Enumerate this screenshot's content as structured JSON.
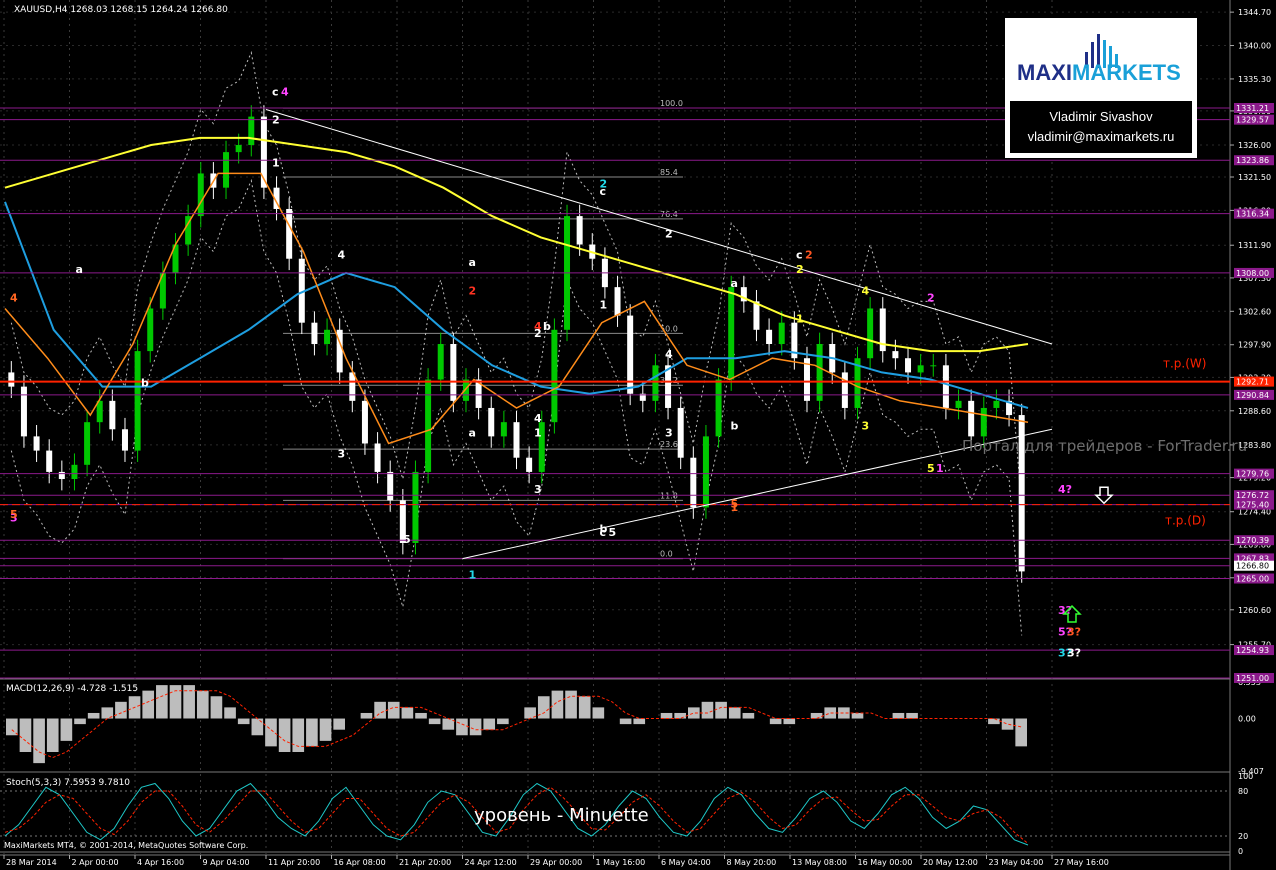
{
  "header": {
    "symbol_info": "XAUUSD,H4  1268.03 1268.15 1264.24 1266.80",
    "macd_info": "MACD(12,26,9) -4.728 -1.515",
    "stoch_info": "Stoch(5,3,3) 7.5953 9.7810"
  },
  "logo": {
    "brand_part1": "MAXI",
    "brand_part2": "MARKETS",
    "author": "Vladimir Sivashov",
    "email": "vladimir@maximarkets.ru"
  },
  "texts": {
    "watermark": "Портал для трейдеров - ForTrader.ru",
    "wave_level": "уровень - Minuette",
    "copyright": "MaxiMarkets MT4, © 2001-2014, MetaQuotes Software Corp."
  },
  "colors": {
    "background": "#000000",
    "bull_candle": "#00c800",
    "bear_candle": "#ffffff",
    "ma_slow": "#ffff33",
    "ma_mid": "#1e9ee0",
    "ma_fast": "#ff8c1a",
    "tp_line": "#ff2200",
    "level_line": "#8b1a8b"
  },
  "chart_data": [
    {
      "type": "line",
      "title": "XAUUSD,H4",
      "ylim": [
        1251.0,
        1345.0
      ],
      "y_ticks": [
        "1344.70",
        "1340.00",
        "1335.30",
        "1330.80",
        "1326.00",
        "1321.50",
        "1316.80",
        "1311.90",
        "1307.30",
        "1302.60",
        "1297.90",
        "1293.30",
        "1288.60",
        "1283.80",
        "1279.20",
        "1274.40",
        "1269.80",
        "1265.10",
        "1260.60",
        "1255.70"
      ],
      "price_tags": [
        "1331.21",
        "1329.57",
        "1323.86",
        "1316.34",
        "1308.00",
        "1292.71",
        "1290.84",
        "1279.76",
        "1276.72",
        "1275.40",
        "1270.39",
        "1267.83",
        "1266.80",
        "1265.00",
        "1254.93",
        "1251.00"
      ],
      "x_ticks": [
        "28 Mar 2014",
        "2 Apr 00:00",
        "4 Apr 16:00",
        "9 Apr 04:00",
        "11 Apr 20:00",
        "16 Apr 08:00",
        "21 Apr 20:00",
        "24 Apr 12:00",
        "29 Apr 00:00",
        "1 May 16:00",
        "6 May 04:00",
        "8 May 20:00",
        "13 May 08:00",
        "16 May 00:00",
        "20 May 12:00",
        "23 May 04:00",
        "27 May 16:00"
      ],
      "close_path": [
        1292,
        1285,
        1283,
        1280,
        1279,
        1281,
        1287,
        1290,
        1286,
        1283,
        1297,
        1303,
        1308,
        1312,
        1316,
        1322,
        1320,
        1325,
        1326,
        1330,
        1320,
        1317,
        1310,
        1301,
        1298,
        1300,
        1294,
        1290,
        1284,
        1280,
        1276,
        1270,
        1280,
        1293,
        1298,
        1290,
        1293,
        1289,
        1285,
        1287,
        1282,
        1280,
        1287,
        1300,
        1316,
        1312,
        1310,
        1306,
        1302,
        1291,
        1290,
        1295,
        1289,
        1282,
        1275,
        1285,
        1293,
        1306,
        1304,
        1300,
        1298,
        1301,
        1296,
        1290,
        1298,
        1294,
        1289,
        1296,
        1303,
        1297,
        1296,
        1294,
        1295,
        1295,
        1289,
        1290,
        1285,
        1289,
        1290,
        1288,
        1266
      ],
      "ma_slow": [
        1320,
        1322,
        1324,
        1326,
        1327,
        1327,
        1326,
        1325,
        1323,
        1320,
        1316,
        1313,
        1311,
        1309,
        1307,
        1305,
        1302,
        1300,
        1298,
        1297,
        1297,
        1298
      ],
      "ma_mid": [
        1318,
        1300,
        1292,
        1292,
        1296,
        1300,
        1305,
        1308,
        1306,
        1300,
        1295,
        1292,
        1291,
        1292,
        1296,
        1296,
        1297,
        1296,
        1294,
        1293,
        1291,
        1289
      ],
      "ma_fast": [
        1303,
        1296,
        1288,
        1298,
        1312,
        1322,
        1322,
        1311,
        1296,
        1284,
        1286,
        1293,
        1289,
        1292,
        1301,
        1304,
        1295,
        1293,
        1296,
        1295,
        1292,
        1290,
        1289,
        1288,
        1287
      ],
      "levels": [
        {
          "name": "т.р.(W)",
          "value": 1292.71
        },
        {
          "name": "т.р.(D)",
          "value": 1275.4
        }
      ],
      "trend_lines": [
        {
          "from": [
            "11 Apr 20:00",
            1331
          ],
          "to": [
            "27 May 16:00",
            1298
          ]
        },
        {
          "from": [
            "24 Apr 12:00",
            1267.8
          ],
          "to": [
            "27 May 16:00",
            1286
          ]
        }
      ],
      "fibonacci": [
        {
          "label": "100.0",
          "value": 1331.2
        },
        {
          "label": "85.4",
          "value": 1321.5
        },
        {
          "label": "76.4",
          "value": 1315.6
        },
        {
          "label": "50.0",
          "value": 1299.5
        },
        {
          "label": "38.2",
          "value": 1292.2
        },
        {
          "label": "23.6",
          "value": 1283.2
        },
        {
          "label": "11.8",
          "value": 1276.0
        },
        {
          "label": "0.0",
          "value": 1267.8
        }
      ],
      "wave_labels": [
        {
          "text": "c",
          "color": "#ffffff",
          "x": "11 Apr 20:00",
          "y": 1333.0
        },
        {
          "text": "4",
          "color": "#ff44ff",
          "x": "11 Apr 20:00",
          "y": 1333.0
        },
        {
          "text": "2",
          "color": "#ffffff",
          "x": "11 Apr 20:00",
          "y": 1329.0
        },
        {
          "text": "1",
          "color": "#ffffff",
          "x": "11 Apr 20:00",
          "y": 1323.0
        },
        {
          "text": "4",
          "color": "#ffffff",
          "x": "16 Apr 08:00",
          "y": 1310.0
        },
        {
          "text": "3",
          "color": "#ffffff",
          "x": "16 Apr 08:00",
          "y": 1282.0
        },
        {
          "text": "5",
          "color": "#ffffff",
          "x": "21 Apr 20:00",
          "y": 1270.0
        },
        {
          "text": "1",
          "color": "#22d8e8",
          "x": "24 Apr 12:00",
          "y": 1265.0
        },
        {
          "text": "a",
          "color": "#ffffff",
          "x": "2 Apr 00:00",
          "y": 1308.0
        },
        {
          "text": "b",
          "color": "#ffffff",
          "x": "4 Apr 16:00",
          "y": 1292.0
        },
        {
          "text": "4",
          "color": "#ff6622",
          "x": "28 Mar 2014",
          "y": 1304.0
        },
        {
          "text": "3",
          "color": "#ff44ff",
          "x": "28 Mar 2014",
          "y": 1273.0
        },
        {
          "text": "5",
          "color": "#ff6622",
          "x": "28 Mar 2014",
          "y": 1273.5
        },
        {
          "text": "a",
          "color": "#ffffff",
          "x": "24 Apr 12:00",
          "y": 1309.0
        },
        {
          "text": "2",
          "color": "#ff3322",
          "x": "24 Apr 12:00",
          "y": 1305.0
        },
        {
          "text": "4",
          "color": "#ff3322",
          "x": "29 Apr 00:00",
          "y": 1300.0
        },
        {
          "text": "b",
          "color": "#ffffff",
          "x": "29 Apr 00:00",
          "y": 1300.0
        },
        {
          "text": "2",
          "color": "#ffffff",
          "x": "29 Apr 00:00",
          "y": 1299.0
        },
        {
          "text": "a",
          "color": "#ffffff",
          "x": "24 Apr 12:00",
          "y": 1285.0
        },
        {
          "text": "1",
          "color": "#ffffff",
          "x": "29 Apr 00:00",
          "y": 1285.0
        },
        {
          "text": "4",
          "color": "#ffffff",
          "x": "29 Apr 00:00",
          "y": 1287.0
        },
        {
          "text": "3",
          "color": "#ffffff",
          "x": "29 Apr 00:00",
          "y": 1277.0
        },
        {
          "text": "c",
          "color": "#ffffff",
          "x": "1 May 16:00",
          "y": 1271.0
        },
        {
          "text": "5",
          "color": "#ffffff",
          "x": "1 May 16:00",
          "y": 1271.0
        },
        {
          "text": "b",
          "color": "#ffffff",
          "x": "1 May 16:00",
          "y": 1271.5
        },
        {
          "text": "c",
          "color": "#ffffff",
          "x": "1 May 16:00",
          "y": 1319.0
        },
        {
          "text": "2",
          "color": "#22d8e8",
          "x": "1 May 16:00",
          "y": 1320.0
        },
        {
          "text": "2",
          "color": "#ffffff",
          "x": "6 May 04:00",
          "y": 1313.0
        },
        {
          "text": "1",
          "color": "#ffffff",
          "x": "1 May 16:00",
          "y": 1303.0
        },
        {
          "text": "4",
          "color": "#ffffff",
          "x": "6 May 04:00",
          "y": 1296.0
        },
        {
          "text": "3",
          "color": "#ffffff",
          "x": "6 May 04:00",
          "y": 1285.0
        },
        {
          "text": "5",
          "color": "#ff6622",
          "x": "8 May 20:00",
          "y": 1275.0
        },
        {
          "text": "1",
          "color": "#ff6622",
          "x": "8 May 20:00",
          "y": 1274.5
        },
        {
          "text": "a",
          "color": "#ffffff",
          "x": "8 May 20:00",
          "y": 1306.0
        },
        {
          "text": "b",
          "color": "#ffffff",
          "x": "8 May 20:00",
          "y": 1286.0
        },
        {
          "text": "c",
          "color": "#ffffff",
          "x": "13 May 08:00",
          "y": 1310.0
        },
        {
          "text": "2",
          "color": "#ff5522",
          "x": "13 May 08:00",
          "y": 1310.0
        },
        {
          "text": "2",
          "color": "#ffff33",
          "x": "13 May 08:00",
          "y": 1308.0
        },
        {
          "text": "1",
          "color": "#ffff33",
          "x": "13 May 08:00",
          "y": 1301.0
        },
        {
          "text": "3",
          "color": "#ffff33",
          "x": "16 May 00:00",
          "y": 1286.0
        },
        {
          "text": "4",
          "color": "#ffff33",
          "x": "16 May 00:00",
          "y": 1305.0
        },
        {
          "text": "2",
          "color": "#ff44ff",
          "x": "20 May 12:00",
          "y": 1304.0
        },
        {
          "text": "5",
          "color": "#ffff33",
          "x": "20 May 12:00",
          "y": 1280.0
        },
        {
          "text": "1",
          "color": "#ff44ff",
          "x": "20 May 12:00",
          "y": 1280.0
        },
        {
          "text": "4?",
          "color": "#ff44ff",
          "x": "27 May 16:00",
          "y": 1277.0
        },
        {
          "text": "3?",
          "color": "#ff44ff",
          "x": "27 May 16:00",
          "y": 1260.0
        },
        {
          "text": "5?",
          "color": "#ff44ff",
          "x": "27 May 16:00",
          "y": 1257.0
        },
        {
          "text": "3?",
          "color": "#ff5522",
          "x": "27 May 16:00",
          "y": 1257.0
        },
        {
          "text": "3?",
          "color": "#22d8e8",
          "x": "27 May 16:00",
          "y": 1254.0
        },
        {
          "text": "3?",
          "color": "#ffffff",
          "x": "27 May 16:00",
          "y": 1254.0
        }
      ]
    },
    {
      "type": "bar",
      "title": "MACD(12,26,9) -4.728 -1.515",
      "ylim": [
        -9.407,
        6.553
      ],
      "y_ticks": [
        "6.553",
        "0.00",
        "-9.407"
      ],
      "main": [
        -3,
        -6,
        -8,
        -6,
        -4,
        -1,
        1,
        2,
        3,
        4,
        5,
        6,
        6,
        6,
        5,
        4,
        2,
        -1,
        -3,
        -5,
        -6,
        -6,
        -5,
        -4,
        -2,
        0,
        1,
        3,
        3,
        2,
        1,
        -1,
        -2,
        -3,
        -3,
        -2,
        -1,
        0,
        2,
        4,
        5,
        5,
        4,
        2,
        0,
        -1,
        -1,
        0,
        1,
        1,
        2,
        3,
        3,
        2,
        1,
        0,
        -1,
        -1,
        0,
        1,
        2,
        2,
        1,
        0,
        0,
        1,
        1,
        0,
        0,
        0,
        0,
        0,
        -1,
        -2,
        -5
      ],
      "signal": [
        -2,
        -4,
        -6,
        -7,
        -6,
        -4,
        -2,
        0,
        1,
        2,
        3,
        4,
        5,
        5,
        5,
        5,
        4,
        2,
        0,
        -2,
        -4,
        -5,
        -5,
        -5,
        -4,
        -3,
        -1,
        1,
        2,
        2,
        2,
        1,
        0,
        -1,
        -2,
        -2,
        -2,
        -1,
        0,
        1,
        3,
        4,
        4,
        4,
        3,
        1,
        0,
        0,
        0,
        0,
        1,
        1,
        2,
        2,
        2,
        1,
        0,
        0,
        0,
        0,
        1,
        1,
        1,
        1,
        0,
        0,
        0,
        0,
        0,
        0,
        0,
        0,
        0,
        -1,
        -1.5
      ]
    },
    {
      "type": "line",
      "title": "Stoch(5,3,3) 7.5953 9.7810",
      "ylim": [
        0,
        100
      ],
      "y_ticks": [
        "100",
        "80",
        "20",
        "0"
      ],
      "main": [
        20,
        35,
        60,
        85,
        75,
        50,
        25,
        15,
        30,
        60,
        85,
        90,
        70,
        40,
        20,
        30,
        55,
        80,
        90,
        70,
        45,
        30,
        20,
        40,
        70,
        85,
        60,
        35,
        20,
        15,
        35,
        65,
        80,
        75,
        50,
        25,
        20,
        45,
        75,
        90,
        80,
        55,
        30,
        20,
        35,
        60,
        80,
        70,
        45,
        25,
        20,
        40,
        70,
        85,
        75,
        50,
        30,
        25,
        45,
        70,
        80,
        65,
        40,
        30,
        50,
        75,
        85,
        70,
        45,
        30,
        40,
        60,
        55,
        35,
        15,
        8
      ],
      "signal": [
        25,
        30,
        45,
        65,
        75,
        70,
        50,
        30,
        22,
        40,
        65,
        80,
        80,
        60,
        35,
        25,
        40,
        60,
        80,
        80,
        60,
        40,
        25,
        30,
        50,
        70,
        70,
        50,
        30,
        20,
        25,
        45,
        65,
        75,
        65,
        45,
        25,
        30,
        55,
        75,
        85,
        70,
        50,
        30,
        28,
        45,
        65,
        75,
        60,
        40,
        25,
        30,
        50,
        70,
        78,
        65,
        45,
        30,
        35,
        55,
        70,
        72,
        55,
        40,
        42,
        60,
        75,
        75,
        60,
        45,
        40,
        50,
        55,
        45,
        25,
        10
      ]
    }
  ]
}
